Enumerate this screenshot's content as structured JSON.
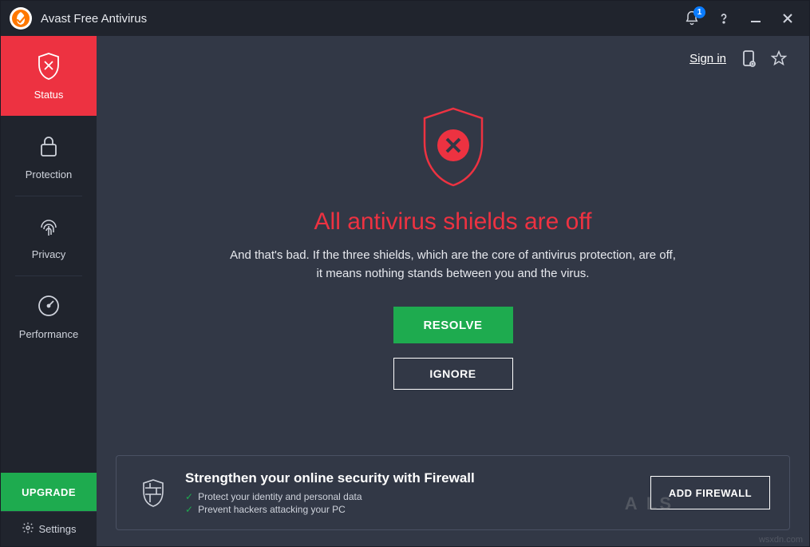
{
  "titlebar": {
    "app_title": "Avast Free Antivirus",
    "notifications": "1"
  },
  "sidebar": {
    "items": [
      {
        "label": "Status"
      },
      {
        "label": "Protection"
      },
      {
        "label": "Privacy"
      },
      {
        "label": "Performance"
      }
    ],
    "upgrade_label": "UPGRADE",
    "settings_label": "Settings"
  },
  "top_actions": {
    "sign_in": "Sign in"
  },
  "status": {
    "heading": "All antivirus shields are off",
    "description": "And that's bad. If the three shields, which are the core of antivirus protection, are off, it means nothing stands between you and the virus.",
    "resolve_label": "RESOLVE",
    "ignore_label": "IGNORE"
  },
  "footer": {
    "title": "Strengthen your online security with Firewall",
    "bullets": [
      "Protect your identity and personal data",
      "Prevent hackers attacking your PC"
    ],
    "button_label": "ADD FIREWALL"
  },
  "watermarks": {
    "corner": "wsxdn.com",
    "brand": "A    LS"
  },
  "colors": {
    "accent_red": "#ed3241",
    "accent_green": "#1eab4f",
    "bg_dark": "#20242d",
    "bg_main": "#323846"
  }
}
